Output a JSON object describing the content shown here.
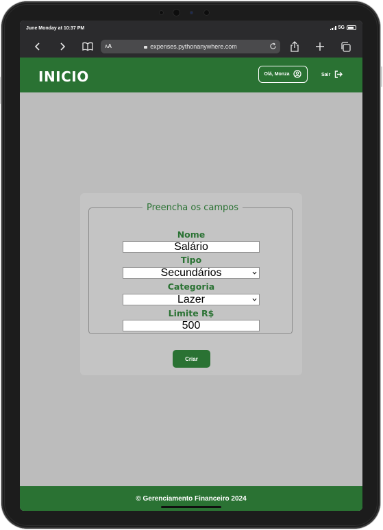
{
  "status_bar": {
    "time": "June Monday at 10:37 PM",
    "network": "5G"
  },
  "browser": {
    "aa_label_small": "A",
    "aa_label_big": "A",
    "url": "expenses.pythonanywhere.com"
  },
  "header": {
    "title": "INICIO",
    "greeting": "Olá, Monza",
    "logout_label": "Sair"
  },
  "form": {
    "legend": "Preencha os campos",
    "fields": [
      {
        "label": "Nome",
        "value": "Salário"
      },
      {
        "label": "Tipo",
        "value": "Secundários"
      },
      {
        "label": "Categoria",
        "value": "Lazer"
      },
      {
        "label": "Limite R$",
        "value": "500"
      }
    ],
    "submit_label": "Criar"
  },
  "footer": {
    "text": "© Gerenciamento Financeiro 2024"
  },
  "colors": {
    "brand_green": "#2a7233",
    "page_background": "#bcbcbc",
    "card_background": "#c4c4c4",
    "browser_chrome": "#2b2b2d"
  }
}
